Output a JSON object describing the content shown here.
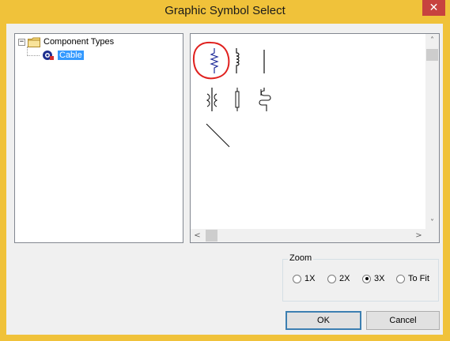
{
  "window": {
    "title": "Graphic Symbol Select",
    "close_glyph": "✕"
  },
  "tree": {
    "root_expander": "−",
    "root_label": "Component Types",
    "root_icon": "folder-icon",
    "child_label": "Cable",
    "child_icon": "cable-icon"
  },
  "symbols": {
    "items": [
      "resistor-zigzag-symbol",
      "inductor-coil-symbol",
      "vertical-line-symbol",
      "transformer-symbol",
      "capacitor-rod-symbol",
      "coil-s-symbol",
      "diagonal-line-symbol"
    ],
    "highlight_color": "#e0201e",
    "symbol_color": "#1f2b9a",
    "scroll_up": "˄",
    "scroll_down": "˅",
    "scroll_left": "<",
    "scroll_right": ">"
  },
  "zoom": {
    "legend": "Zoom",
    "options": [
      "1X",
      "2X",
      "3X",
      "To Fit"
    ],
    "selected": "3X"
  },
  "buttons": {
    "ok": "OK",
    "cancel": "Cancel"
  }
}
